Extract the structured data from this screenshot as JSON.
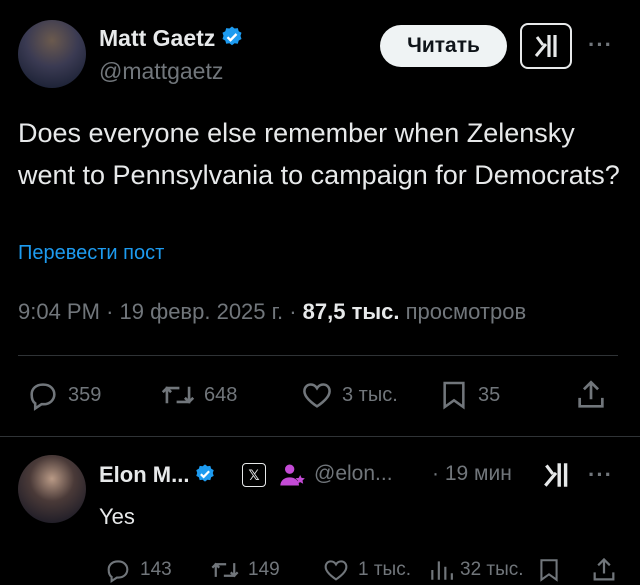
{
  "main_tweet": {
    "author_name": "Matt Gaetz",
    "handle": "@mattgaetz",
    "read_button": "Читать",
    "text": "Does everyone else remember when Zelensky went to Pennsylvania to campaign for Democrats?",
    "translate_link": "Перевести пост",
    "time": "9:04 PM",
    "date": "19 февр. 2025 г.",
    "views_count": "87,5 тыс.",
    "views_label": "просмотров",
    "replies": "359",
    "reposts": "648",
    "likes": "3 тыс.",
    "bookmarks": "35"
  },
  "reply": {
    "author_name": "Elon M...",
    "badge": "𝕏",
    "handle": "@elon...",
    "time": "· 19 мин",
    "text": "Yes",
    "replies": "143",
    "reposts": "149",
    "likes": "1 тыс.",
    "views": "32 тыс."
  },
  "colors": {
    "background": "#000000",
    "accent": "#1d9bf0",
    "muted": "#71767b",
    "text": "#e7e9ea"
  },
  "icons": [
    "verified-badge-icon",
    "grok-icon",
    "more-icon",
    "reply-icon",
    "repost-icon",
    "like-icon",
    "bookmark-icon",
    "share-icon",
    "views-icon",
    "affiliate-icon"
  ]
}
